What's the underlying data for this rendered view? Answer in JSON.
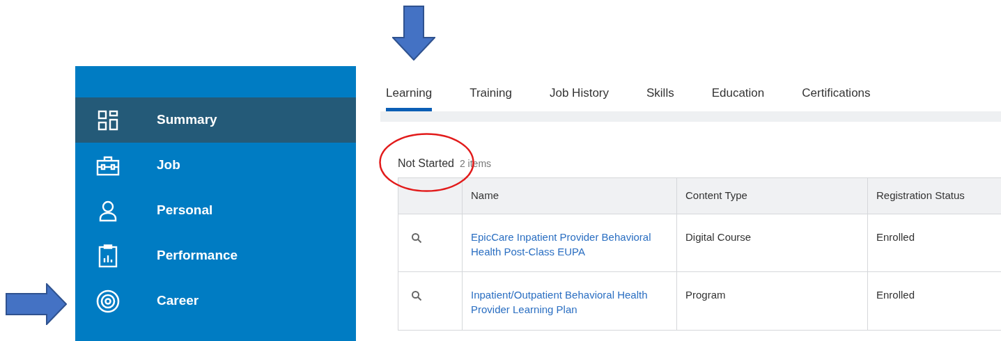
{
  "sidebar": {
    "items": [
      {
        "label": "Summary",
        "selected": true
      },
      {
        "label": "Job",
        "selected": false
      },
      {
        "label": "Personal",
        "selected": false
      },
      {
        "label": "Performance",
        "selected": false
      },
      {
        "label": "Career",
        "selected": false
      }
    ]
  },
  "tabs": [
    {
      "label": "Learning",
      "selected": true
    },
    {
      "label": "Training",
      "selected": false
    },
    {
      "label": "Job History",
      "selected": false
    },
    {
      "label": "Skills",
      "selected": false
    },
    {
      "label": "Education",
      "selected": false
    },
    {
      "label": "Certifications",
      "selected": false
    }
  ],
  "section": {
    "title": "Not Started",
    "count": "2 items"
  },
  "table": {
    "columns": [
      "Name",
      "Content Type",
      "Registration Status"
    ],
    "rows": [
      {
        "name": "EpicCare Inpatient Provider Behavioral Health Post-Class EUPA",
        "content_type": "Digital Course",
        "registration_status": "Enrolled"
      },
      {
        "name": "Inpatient/Outpatient Behavioral Health Provider Learning Plan",
        "content_type": "Program",
        "registration_status": "Enrolled"
      }
    ]
  }
}
